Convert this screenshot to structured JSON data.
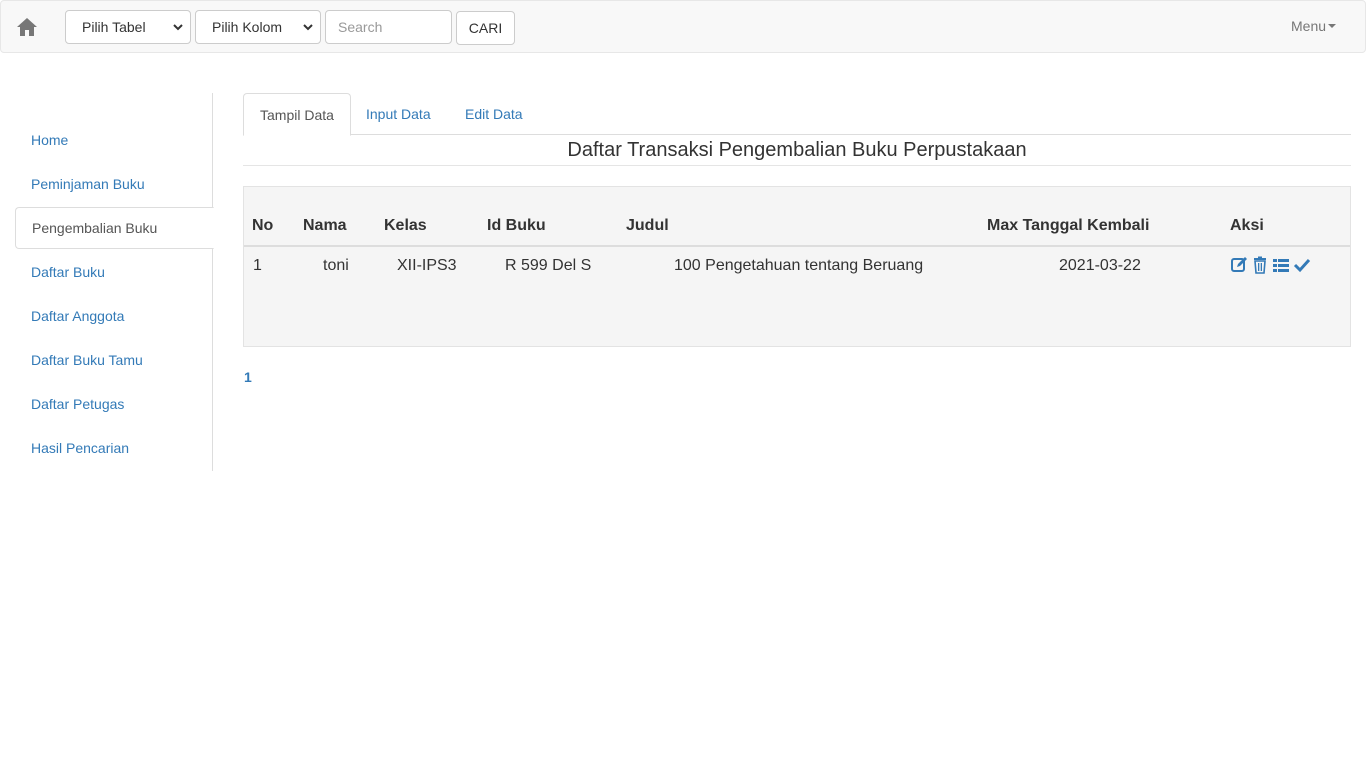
{
  "navbar": {
    "home_icon": "home-icon",
    "select_table": "Pilih Tabel",
    "select_column": "Pilih Kolom",
    "search_placeholder": "Search",
    "search_button": "CARI",
    "menu_label": "Menu"
  },
  "sidebar": {
    "items": [
      {
        "label": "Home",
        "active": false
      },
      {
        "label": "Peminjaman Buku",
        "active": false
      },
      {
        "label": "Pengembalian Buku",
        "active": true
      },
      {
        "label": "Daftar Buku",
        "active": false
      },
      {
        "label": "Daftar Anggota",
        "active": false
      },
      {
        "label": "Daftar Buku Tamu",
        "active": false
      },
      {
        "label": "Daftar Petugas",
        "active": false
      },
      {
        "label": "Hasil Pencarian",
        "active": false
      }
    ]
  },
  "tabs": [
    {
      "label": "Tampil Data",
      "active": true
    },
    {
      "label": "Input Data",
      "active": false
    },
    {
      "label": "Edit Data",
      "active": false
    }
  ],
  "page_title": "Daftar Transaksi Pengembalian Buku Perpustakaan",
  "table": {
    "headers": [
      "No",
      "Nama",
      "Kelas",
      "Id Buku",
      "Judul",
      "Max Tanggal Kembali",
      "Aksi"
    ],
    "rows": [
      {
        "no": "1",
        "nama": "toni",
        "kelas": "XII-IPS3",
        "id_buku": "R 599 Del S",
        "judul": "100 Pengetahuan tentang Beruang",
        "max_tanggal_kembali": "2021-03-22",
        "actions": [
          "edit-icon",
          "trash-icon",
          "list-icon",
          "check-icon"
        ]
      }
    ]
  },
  "pagination": {
    "current_page": "1"
  },
  "colors": {
    "link": "#337ab7",
    "navbar_bg": "#f8f8f8",
    "panel_bg": "#f5f5f5"
  }
}
